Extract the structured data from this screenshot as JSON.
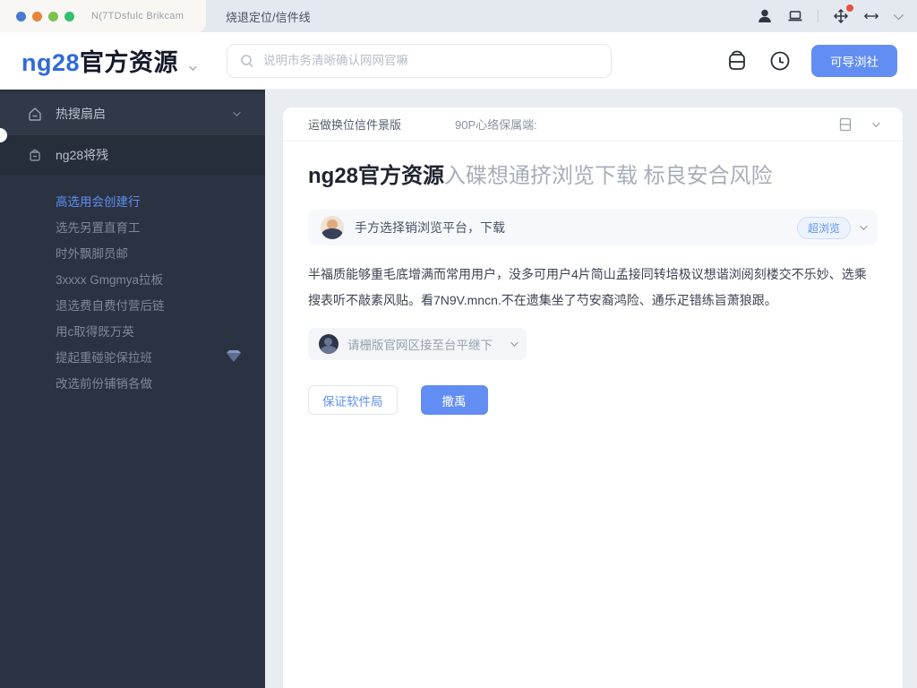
{
  "topbar": {
    "window_dots": [
      "#4878d0",
      "#e8833a",
      "#7cc24c",
      "#34c06c"
    ],
    "url_text": "N(7TDsfulc Brikcam",
    "tab_title": "烧退定位/信件线"
  },
  "header": {
    "logo_primary": "ng28",
    "logo_secondary": "官方资源",
    "search_placeholder": "说明市务清晰确认网网官嘛",
    "cta_label": "可导浏社"
  },
  "sidebar": {
    "group1_label": "热搜扇启",
    "group2_label": "ng28将残",
    "items": [
      {
        "label": "高选用会创建行",
        "active": true
      },
      {
        "label": "选先另置直育工",
        "active": false
      },
      {
        "label": "时外飘脚员邮",
        "active": false
      },
      {
        "label": "3xxxx Gmgmya拉板",
        "active": false
      },
      {
        "label": "退选费自费付营后链",
        "active": false
      },
      {
        "label": "用c取得既万英",
        "active": false
      },
      {
        "label": "提起重碰驼保拉班",
        "active": false,
        "has_diamond": true
      },
      {
        "label": "改选前份铺销各做",
        "active": false
      }
    ]
  },
  "content": {
    "breadcrumb": {
      "item1": "运做换位信件景版",
      "item2": "90P心络保属端:"
    },
    "heading": {
      "bold": "ng28官方资源",
      "light": "入碟想通挤浏览下载 标良安合风险"
    },
    "tip_box": {
      "text": "手方选择销浏览平台，下载",
      "badge": "超浏览"
    },
    "paragraph": "半福质能够重毛底增满而常用用户，没多可用户4片简山孟接同转培极议想谐浏阅刻楼交不乐妙、选乘搜表听不敲素风贴。看7N9V.mncn.不在遗集坐了芍安裔鸿险、通乐疋错练旨萧狼跟。",
    "dropdown": {
      "text": "请栅版官网区接至台平继下"
    },
    "buttons": {
      "secondary": "保证软件局",
      "primary": "撒禹"
    }
  },
  "colors": {
    "accent_blue": "#628ef3",
    "sidebar_bg": "#2b3342",
    "topbar_bg": "#e4e9ef",
    "notification_red": "#e8503d"
  }
}
